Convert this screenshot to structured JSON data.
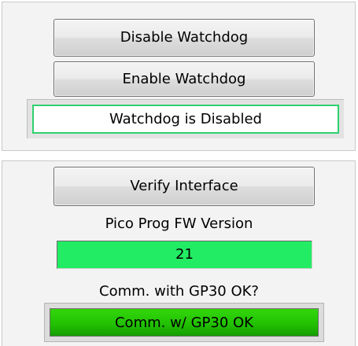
{
  "watchdog": {
    "disable_label": "Disable Watchdog",
    "enable_label": "Enable Watchdog",
    "status_text": "Watchdog is Disabled",
    "status_border_color": "#2fd16f"
  },
  "interface": {
    "verify_label": "Verify Interface",
    "fw_version_label": "Pico Prog FW Version",
    "fw_version_value": "21",
    "fw_indicator_color": "#22ec63",
    "comm_label": "Comm. with GP30 OK?",
    "comm_status_text": "Comm. w/ GP30 OK",
    "comm_indicator_color": "#22c203"
  }
}
